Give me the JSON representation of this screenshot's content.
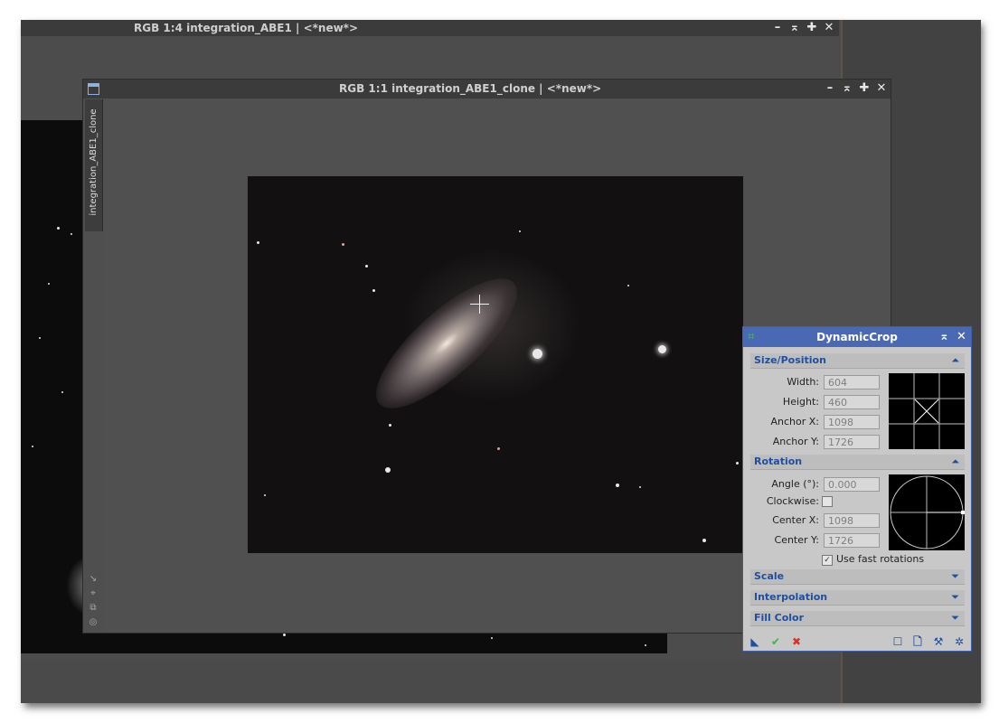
{
  "back_window": {
    "title": "RGB 1:4 integration_ABE1 | <*new*>",
    "controls": [
      "–",
      "⌅",
      "✚",
      "✕"
    ]
  },
  "front_window": {
    "title": "RGB 1:1 integration_ABE1_clone | <*new*>",
    "controls": [
      "–",
      "⌅",
      "✚",
      "✕"
    ],
    "view_tab": "integration_ABE1_clone",
    "side_icons": [
      "↘",
      "⌖",
      "⧉",
      "◎"
    ]
  },
  "dynamic_crop": {
    "title": "DynamicCrop",
    "size_position": {
      "label": "Size/Position",
      "width_label": "Width:",
      "width": "604",
      "height_label": "Height:",
      "height": "460",
      "anchor_x_label": "Anchor X:",
      "anchor_x": "1098",
      "anchor_y_label": "Anchor Y:",
      "anchor_y": "1726"
    },
    "rotation": {
      "label": "Rotation",
      "angle_label": "Angle (°):",
      "angle": "0.000",
      "clockwise_label": "Clockwise:",
      "center_x_label": "Center X:",
      "center_x": "1098",
      "center_y_label": "Center Y:",
      "center_y": "1726",
      "fast_label": "Use fast rotations"
    },
    "scale_label": "Scale",
    "interpolation_label": "Interpolation",
    "fill_color_label": "Fill Color",
    "colors": {
      "accent": "#4a69b5",
      "ok": "#39b54a",
      "cancel": "#d9302a"
    }
  }
}
